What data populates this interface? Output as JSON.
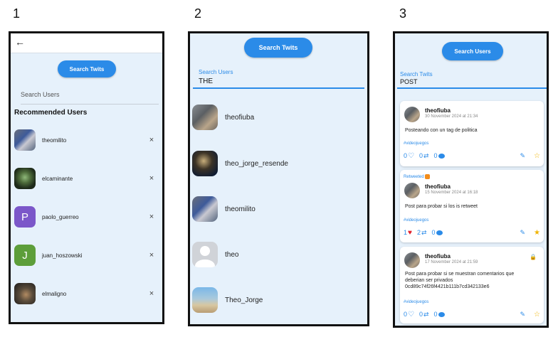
{
  "panel_numbers": [
    "1",
    "2",
    "3"
  ],
  "panel1": {
    "search_button": "Search Twits",
    "search_placeholder": "Search Users",
    "section_title": "Recommended Users",
    "users": [
      {
        "name": "theomilito",
        "avatar": "photo"
      },
      {
        "name": "elcaminante",
        "avatar": "photo"
      },
      {
        "name": "paolo_guerreo",
        "avatar": "letter",
        "letter": "P",
        "color": "#7b57c9"
      },
      {
        "name": "juan_hoszowski",
        "avatar": "letter",
        "letter": "J",
        "color": "#5d9e3a"
      },
      {
        "name": "elmaligno",
        "avatar": "photo"
      }
    ],
    "remove_glyph": "×"
  },
  "panel2": {
    "search_button": "Search Twits",
    "field_label": "Search Users",
    "field_value": "THE",
    "results": [
      "theofiuba",
      "theo_jorge_resende",
      "theomilito",
      "theo",
      "Theo_Jorge"
    ]
  },
  "panel3": {
    "search_button": "Search Users",
    "field_label": "Search Twits",
    "field_value": "POST",
    "posts": [
      {
        "retweeted_label": "",
        "user": "theofiuba",
        "date": "30 November 2024 at 21:34",
        "body": "Posteando con un tag de politica",
        "tag": "#videojuegos",
        "likes": "0",
        "retweets": "0",
        "comments": "0",
        "liked": false,
        "starred": false,
        "private": false
      },
      {
        "retweeted_label": "Retweeted",
        "user": "theofiuba",
        "date": "15 November 2024 at 16:18",
        "body": "Post para probar si los is retweet",
        "tag": "#videojuegos",
        "likes": "1",
        "retweets": "2",
        "comments": "0",
        "liked": true,
        "starred": true,
        "private": false
      },
      {
        "retweeted_label": "",
        "user": "theofiuba",
        "date": "17 November 2024 at 21:59",
        "body": "Post para probar si se muestran comentarios que deberian ser privados 0cd89c74f26f4421b111b7cd342133e6",
        "tag": "#videojuegos",
        "likes": "0",
        "retweets": "0",
        "comments": "0",
        "liked": false,
        "starred": false,
        "private": true
      }
    ]
  },
  "colors": {
    "accent": "#2b8be8",
    "background": "#e6f1fb",
    "heart": "#e11d2a",
    "star": "#f0b400"
  }
}
